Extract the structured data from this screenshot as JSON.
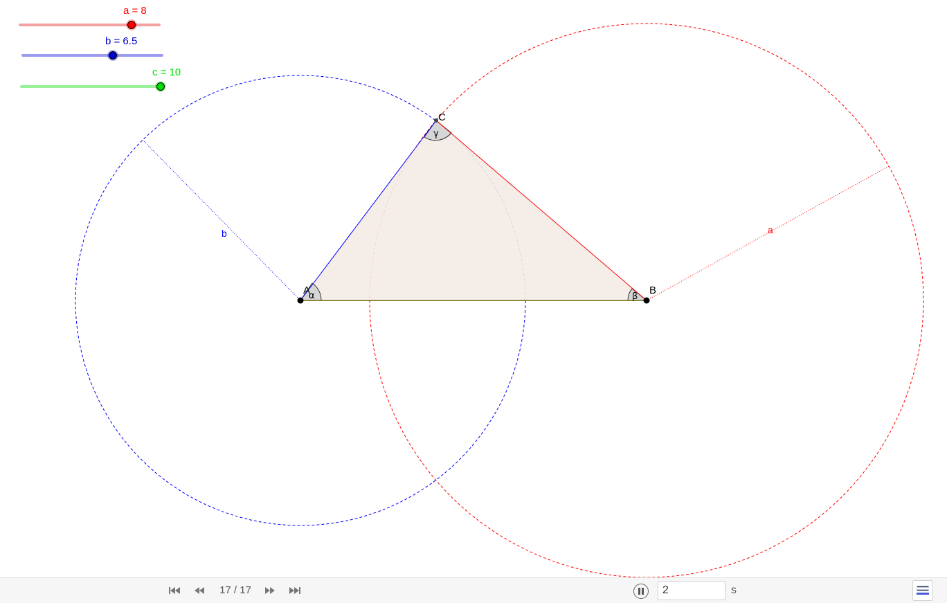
{
  "sliders": {
    "a": {
      "label": "a = 8",
      "value": 8,
      "color": "#ff0000",
      "track_color": "#f4a0a0"
    },
    "b": {
      "label": "b = 6.5",
      "value": 6.5,
      "color": "#0000cc",
      "track_color": "#9b9bf0"
    },
    "c": {
      "label": "c = 10",
      "value": 10,
      "color": "#00dd00",
      "track_color": "#98f098"
    }
  },
  "points": {
    "A": "A",
    "B": "B",
    "C": "C"
  },
  "angles": {
    "alpha": "α",
    "beta": "β",
    "gamma": "γ"
  },
  "radius_labels": {
    "a": "a",
    "b": "b"
  },
  "colors": {
    "triangle_fill": "#f4ebe6",
    "side_a": "#ff0000",
    "side_b": "#0000ff",
    "side_c": "#666600",
    "circle_a": "#ff0000",
    "circle_b": "#0000ff",
    "angle_fill": "#d6d6d6"
  },
  "toolbar": {
    "slide_counter": "17 / 17",
    "speed_value": "2",
    "speed_unit": "s",
    "icons": [
      "skip-first-icon",
      "step-back-icon",
      "step-forward-icon",
      "skip-last-icon",
      "pause-icon",
      "algebra-view-icon"
    ]
  }
}
